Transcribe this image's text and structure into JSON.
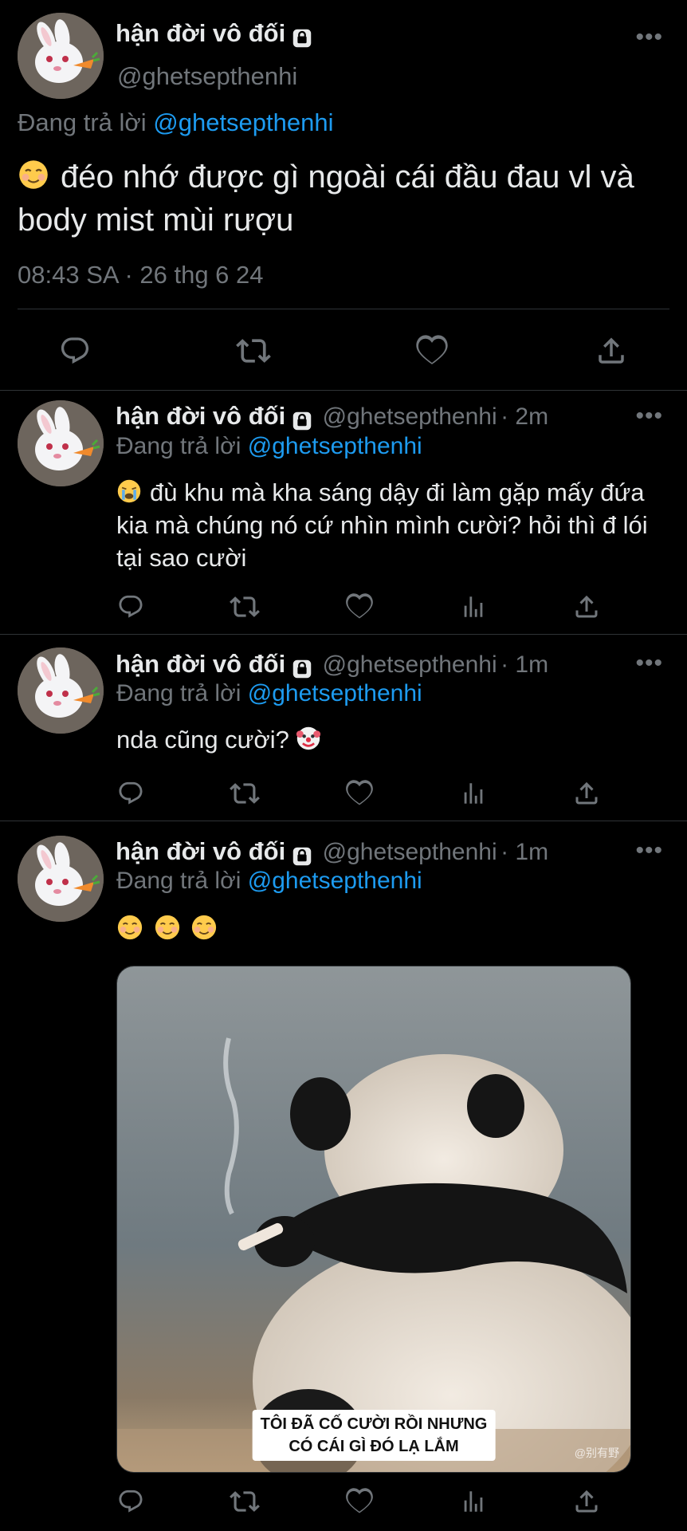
{
  "author": {
    "name": "hận đời vô đối",
    "handle": "@ghetsepthenhi",
    "lock_icon": "lock-icon",
    "more": "•••"
  },
  "colors": {
    "background": "#000000",
    "text": "#e7e9ea",
    "muted": "#71767b",
    "link": "#1d9bf0",
    "divider": "#2f3336"
  },
  "main_tweet": {
    "reply_prefix": "Đang trả lời",
    "reply_to": "@ghetsepthenhi",
    "text": "đéo nhớ được gì ngoài cái đầu đau vl và body mist mùi rượu",
    "emoji": "smiling-face-icon",
    "timestamp": "08:43 SA · 26 thg 6 24",
    "actions": [
      "reply-icon",
      "retweet-icon",
      "like-icon",
      "share-icon"
    ]
  },
  "replies": [
    {
      "time": "· 2m",
      "reply_prefix": "Đang trả lời",
      "reply_to": "@ghetsepthenhi",
      "text": "đù khu mà kha sáng dậy đi làm gặp mấy đứa kia mà chúng nó cứ nhìn mình cười? hỏi thì đ lói tại sao cười",
      "emoji": "loudly-crying-face-icon"
    },
    {
      "time": "· 1m",
      "reply_prefix": "Đang trả lời",
      "reply_to": "@ghetsepthenhi",
      "text": "nda cũng cười?",
      "emoji": "clown-face-icon"
    },
    {
      "time": "· 1m",
      "reply_prefix": "Đang trả lời",
      "reply_to": "@ghetsepthenhi",
      "emoji": "smiling-face-icon",
      "media": {
        "caption_line1": "TÔI ĐÃ CỐ CƯỜI RỒI NHƯNG",
        "caption_line2": "CÓ CÁI GÌ ĐÓ LẠ LẮM",
        "watermark": "@别有野"
      }
    }
  ]
}
